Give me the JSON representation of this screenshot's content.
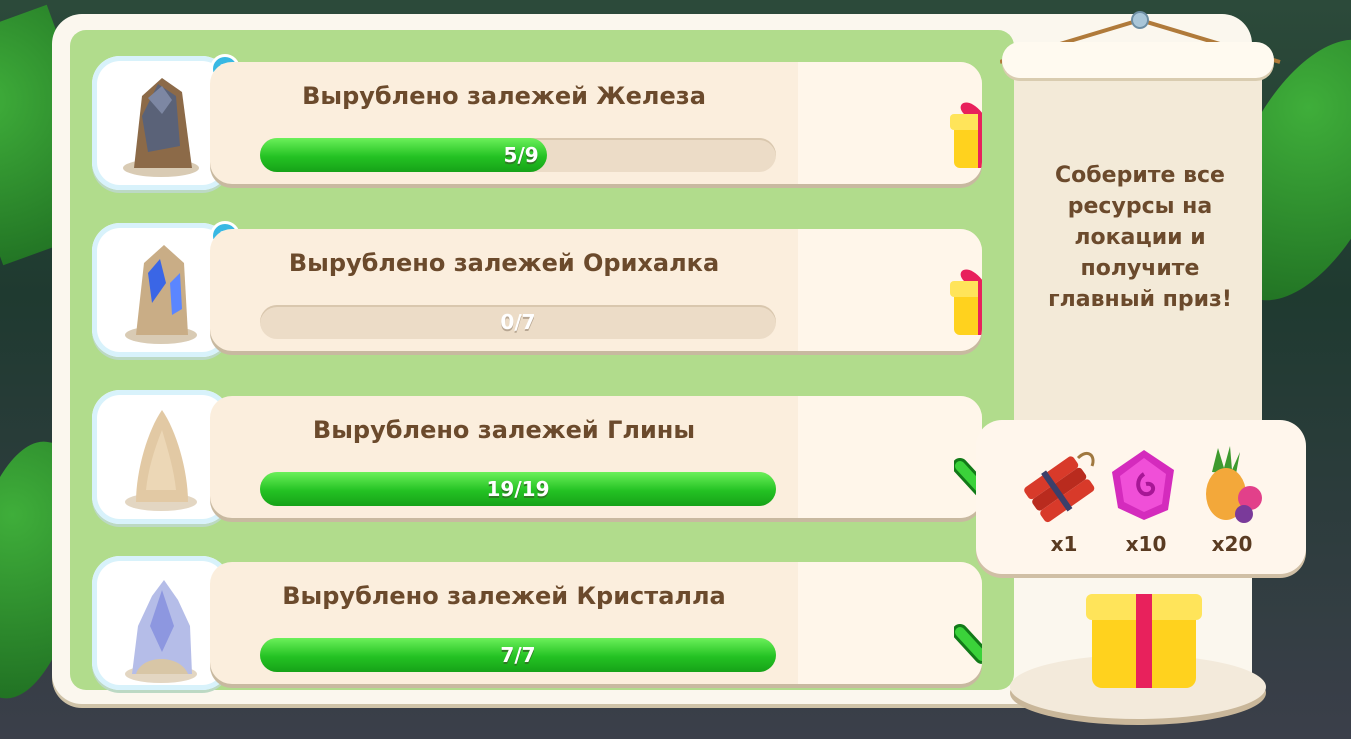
{
  "quests": [
    {
      "resource": "iron",
      "title": "Вырублено залежей Железа",
      "progress_text": "5/9",
      "progress": 0.5556,
      "status": "gift",
      "has_help": true
    },
    {
      "resource": "orichalcum",
      "title": "Вырублено залежей Орихалка",
      "progress_text": "0/7",
      "progress": 0,
      "status": "gift",
      "has_help": true
    },
    {
      "resource": "clay",
      "title": "Вырублено залежей Глины",
      "progress_text": "19/19",
      "progress": 1,
      "status": "complete",
      "has_help": false
    },
    {
      "resource": "crystal",
      "title": "Вырублено залежей Кристалла",
      "progress_text": "7/7",
      "progress": 1,
      "status": "complete",
      "has_help": false
    }
  ],
  "help_icon_text": "?",
  "scroll": {
    "text": "Соберите все ресурсы на локации и получите главный приз!"
  },
  "main_prize": {
    "rewards": [
      {
        "icon": "dynamite-icon",
        "qty": "x1"
      },
      {
        "icon": "pink-gem-icon",
        "qty": "x10"
      },
      {
        "icon": "fruit-basket-icon",
        "qty": "x20"
      }
    ]
  },
  "colors": {
    "progress_green": "#24c223",
    "panel_green": "#b1dc8c",
    "text_brown": "#6b4a2c",
    "gift_red": "#e8215c",
    "gift_yellow": "#ffd21e"
  }
}
